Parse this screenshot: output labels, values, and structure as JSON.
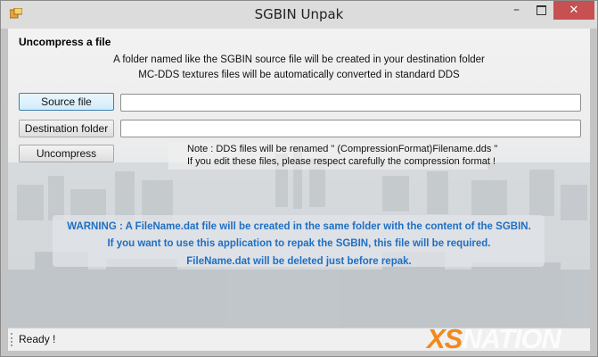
{
  "window": {
    "title": "SGBIN Unpak",
    "minimize_icon": "minimize-icon",
    "maximize_icon": "maximize-icon",
    "close_icon": "close-icon"
  },
  "header": {
    "heading": "Uncompress a file",
    "info_line1": "A folder named like the SGBIN source file will be created in your destination folder",
    "info_line2": "MC-DDS textures files will be automatically converted in standard DDS"
  },
  "form": {
    "source_label": "Source file",
    "source_value": "",
    "destination_label": "Destination folder",
    "destination_value": "",
    "uncompress_label": "Uncompress"
  },
  "note": {
    "line1": "Note : DDS files will be renamed \" (CompressionFormat)Filename.dds \"",
    "line2": "If you edit these files, please respect carefully the compression format !"
  },
  "warning": {
    "line1": "WARNING : A FileName.dat file will be created  in the same folder with the content of the SGBIN.",
    "line2": "If you want to use this application to repak the SGBIN, this file will be required.",
    "line3": "FileName.dat will be deleted just before repak.",
    "color": "#1e6fc4"
  },
  "statusbar": {
    "status": "Ready !"
  },
  "logo": {
    "part1": "XS",
    "part2": "NATION",
    "accent": "#f08a1c"
  }
}
